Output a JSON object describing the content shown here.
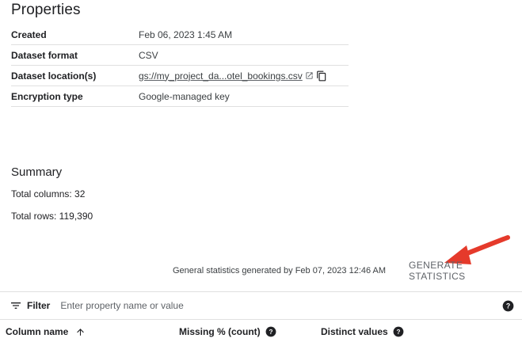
{
  "page": {
    "title": "Properties"
  },
  "properties": [
    {
      "label": "Created",
      "value": "Feb 06, 2023 1:45 AM"
    },
    {
      "label": "Dataset format",
      "value": "CSV"
    },
    {
      "label": "Dataset location(s)",
      "value": "gs://my_project_da...otel_bookings.csv"
    },
    {
      "label": "Encryption type",
      "value": "Google-managed key"
    }
  ],
  "summary": {
    "title": "Summary",
    "total_columns": "Total columns: 32",
    "total_rows": "Total rows: 119,390"
  },
  "statistics": {
    "note": "General statistics generated by Feb 07, 2023 12:46 AM",
    "button_label": "GENERATE STATISTICS"
  },
  "filter": {
    "label": "Filter",
    "placeholder": "Enter property name or value"
  },
  "table": {
    "columns": [
      {
        "label": "Column name"
      },
      {
        "label": "Missing % (count)"
      },
      {
        "label": "Distinct values"
      }
    ]
  },
  "colors": {
    "arrow": "#e53a2b",
    "text_primary": "#202124",
    "text_secondary": "#5f6368",
    "divider": "#e0e0e0"
  },
  "icons": {
    "external_link": "open-in-new-icon",
    "copy": "content-copy-icon",
    "filter": "filter-list-icon",
    "help": "help-icon",
    "sort": "arrow-upward-icon"
  }
}
